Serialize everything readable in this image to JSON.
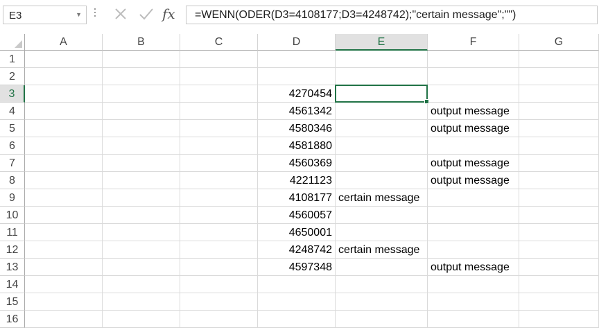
{
  "name_box": "E3",
  "formula": "=WENN(ODER(D3=4108177;D3=4248742);\"certain message\";\"\")",
  "icons": {
    "cancel": "cancel-x-icon",
    "enter": "checkmark-icon",
    "function": "fx-icon"
  },
  "function_label": "fx",
  "accent_color": "#217346",
  "columns": [
    "A",
    "B",
    "C",
    "D",
    "E",
    "F",
    "G"
  ],
  "selected_column": "E",
  "selected_row": "3",
  "rows": [
    {
      "num": "1",
      "D": "",
      "E": "",
      "F": ""
    },
    {
      "num": "2",
      "D": "",
      "E": "",
      "F": ""
    },
    {
      "num": "3",
      "D": "4270454",
      "E": "",
      "F": ""
    },
    {
      "num": "4",
      "D": "4561342",
      "E": "",
      "F": "output message"
    },
    {
      "num": "5",
      "D": "4580346",
      "E": "",
      "F": "output message"
    },
    {
      "num": "6",
      "D": "4581880",
      "E": "",
      "F": ""
    },
    {
      "num": "7",
      "D": "4560369",
      "E": "",
      "F": "output message"
    },
    {
      "num": "8",
      "D": "4221123",
      "E": "",
      "F": "output message"
    },
    {
      "num": "9",
      "D": "4108177",
      "E": "certain message",
      "F": ""
    },
    {
      "num": "10",
      "D": "4560057",
      "E": "",
      "F": ""
    },
    {
      "num": "11",
      "D": "4650001",
      "E": "",
      "F": ""
    },
    {
      "num": "12",
      "D": "4248742",
      "E": "certain message",
      "F": ""
    },
    {
      "num": "13",
      "D": "4597348",
      "E": "",
      "F": "output message"
    },
    {
      "num": "14",
      "D": "",
      "E": "",
      "F": ""
    },
    {
      "num": "15",
      "D": "",
      "E": "",
      "F": ""
    },
    {
      "num": "16",
      "D": "",
      "E": "",
      "F": ""
    }
  ]
}
